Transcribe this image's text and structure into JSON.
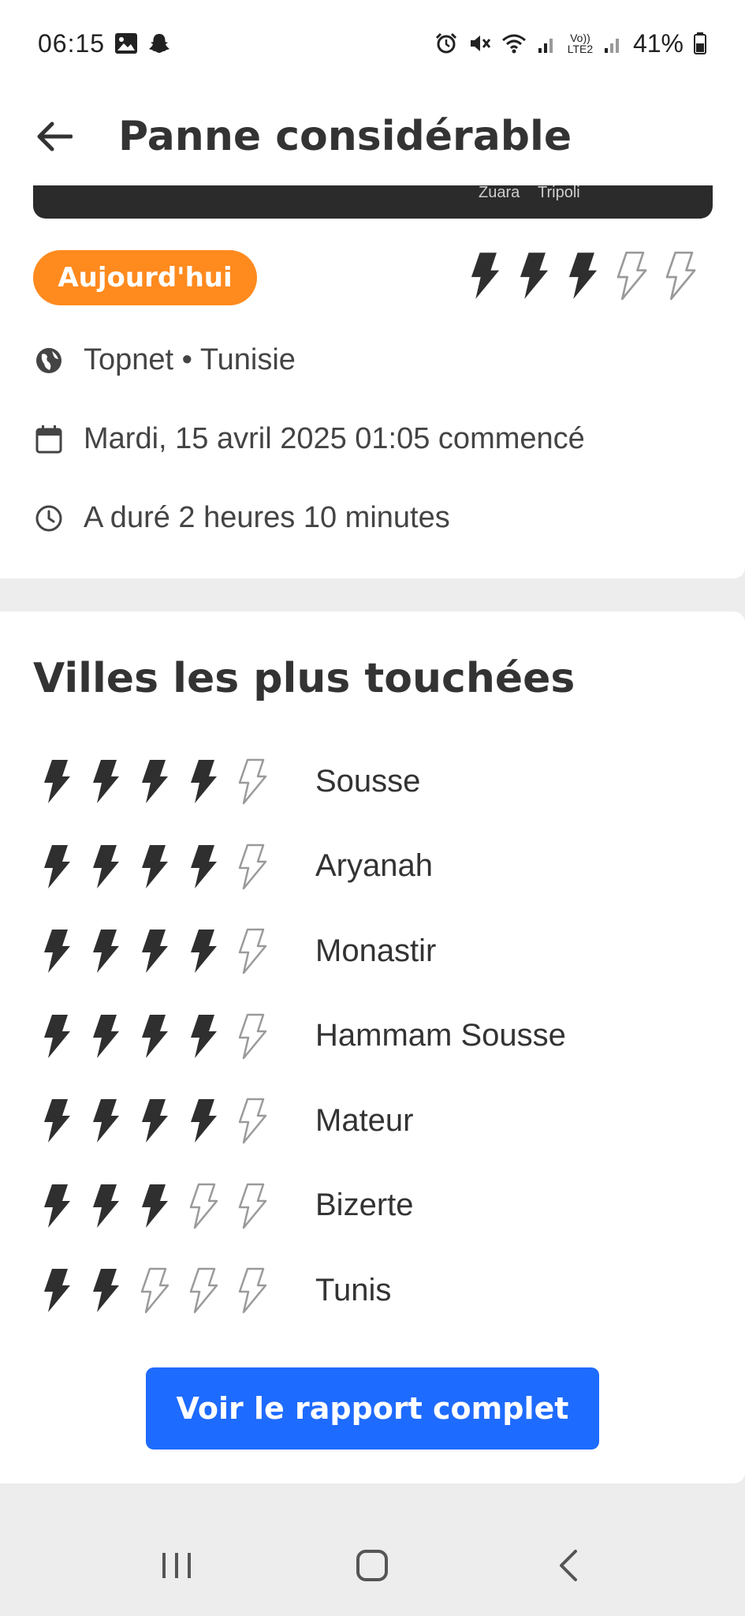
{
  "status_bar": {
    "time": "06:15",
    "lte_label": "Vo)) LTE2",
    "battery": "41%"
  },
  "header": {
    "title": "Panne considérable",
    "back_icon": "arrow-left-icon"
  },
  "map": {
    "labels": [
      "Zuara",
      "Tripoli"
    ]
  },
  "summary": {
    "badge": "Aujourd'hui",
    "badge_color": "#ff8a1e",
    "severity": 3,
    "severity_max": 5,
    "provider": "Topnet • Tunisie",
    "started": "Mardi, 15 avril 2025 01:05 commencé",
    "duration": "A duré 2 heures 10 minutes"
  },
  "cities_section": {
    "title": "Villes les plus touchées",
    "cities": [
      {
        "name": "Sousse",
        "severity": 4
      },
      {
        "name": "Aryanah",
        "severity": 4
      },
      {
        "name": "Monastir",
        "severity": 4
      },
      {
        "name": "Hammam Sousse",
        "severity": 4
      },
      {
        "name": "Mateur",
        "severity": 4
      },
      {
        "name": "Bizerte",
        "severity": 3
      },
      {
        "name": "Tunis",
        "severity": 2
      }
    ]
  },
  "report_button": {
    "label": "Voir le rapport complet",
    "color": "#1e6bff"
  }
}
